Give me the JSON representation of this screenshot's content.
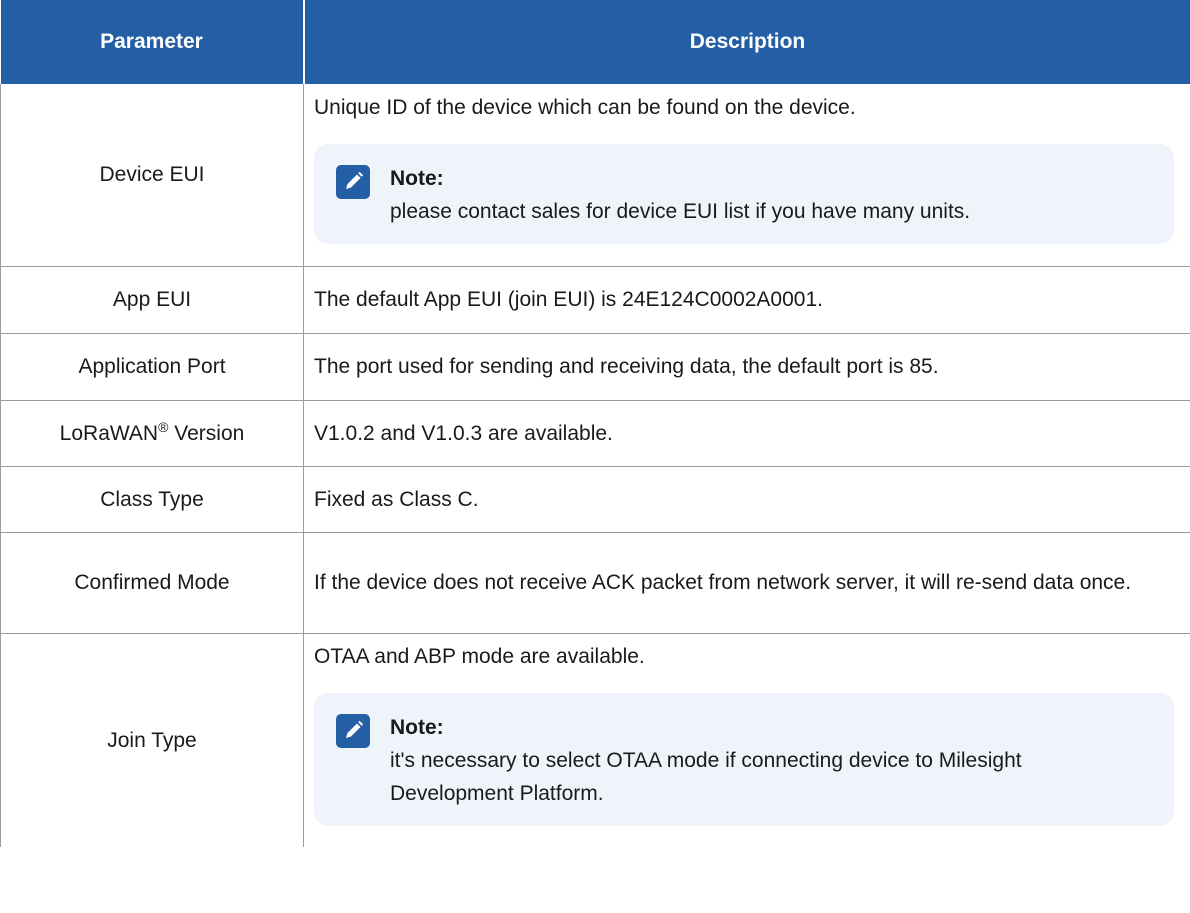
{
  "table": {
    "headers": {
      "parameter": "Parameter",
      "description": "Description"
    },
    "rows": [
      {
        "parameter": "Device EUI",
        "description": "Unique ID of the device which can be found on the device.",
        "note": {
          "title": "Note:",
          "body": "please contact sales for device EUI list if you have many units."
        }
      },
      {
        "parameter": "App EUI",
        "description": "The default App EUI (join EUI) is 24E124C0002A0001."
      },
      {
        "parameter": "Application Port",
        "description": "The port used for sending and receiving data, the default port is 85."
      },
      {
        "parameter": "LoRaWAN",
        "parameter_sup": "®",
        "parameter_suffix": " Version",
        "description": "V1.0.2 and V1.0.3 are available."
      },
      {
        "parameter": "Class Type",
        "description": "Fixed as Class C."
      },
      {
        "parameter": "Confirmed Mode",
        "description": "If the device does not receive ACK packet from network server, it will re-send data once."
      },
      {
        "parameter": "Join Type",
        "description": "OTAA and ABP mode are available.",
        "note": {
          "title": "Note:",
          "body": "it's necessary to select OTAA mode if connecting device to Milesight Development Platform."
        }
      }
    ]
  },
  "colors": {
    "header_bg": "#245fa6",
    "header_text": "#ffffff",
    "note_bg": "#eef4f9",
    "note_icon": "#245fa6",
    "border": "#9a9a9a"
  },
  "icons": {
    "note": "pencil-note-icon"
  }
}
